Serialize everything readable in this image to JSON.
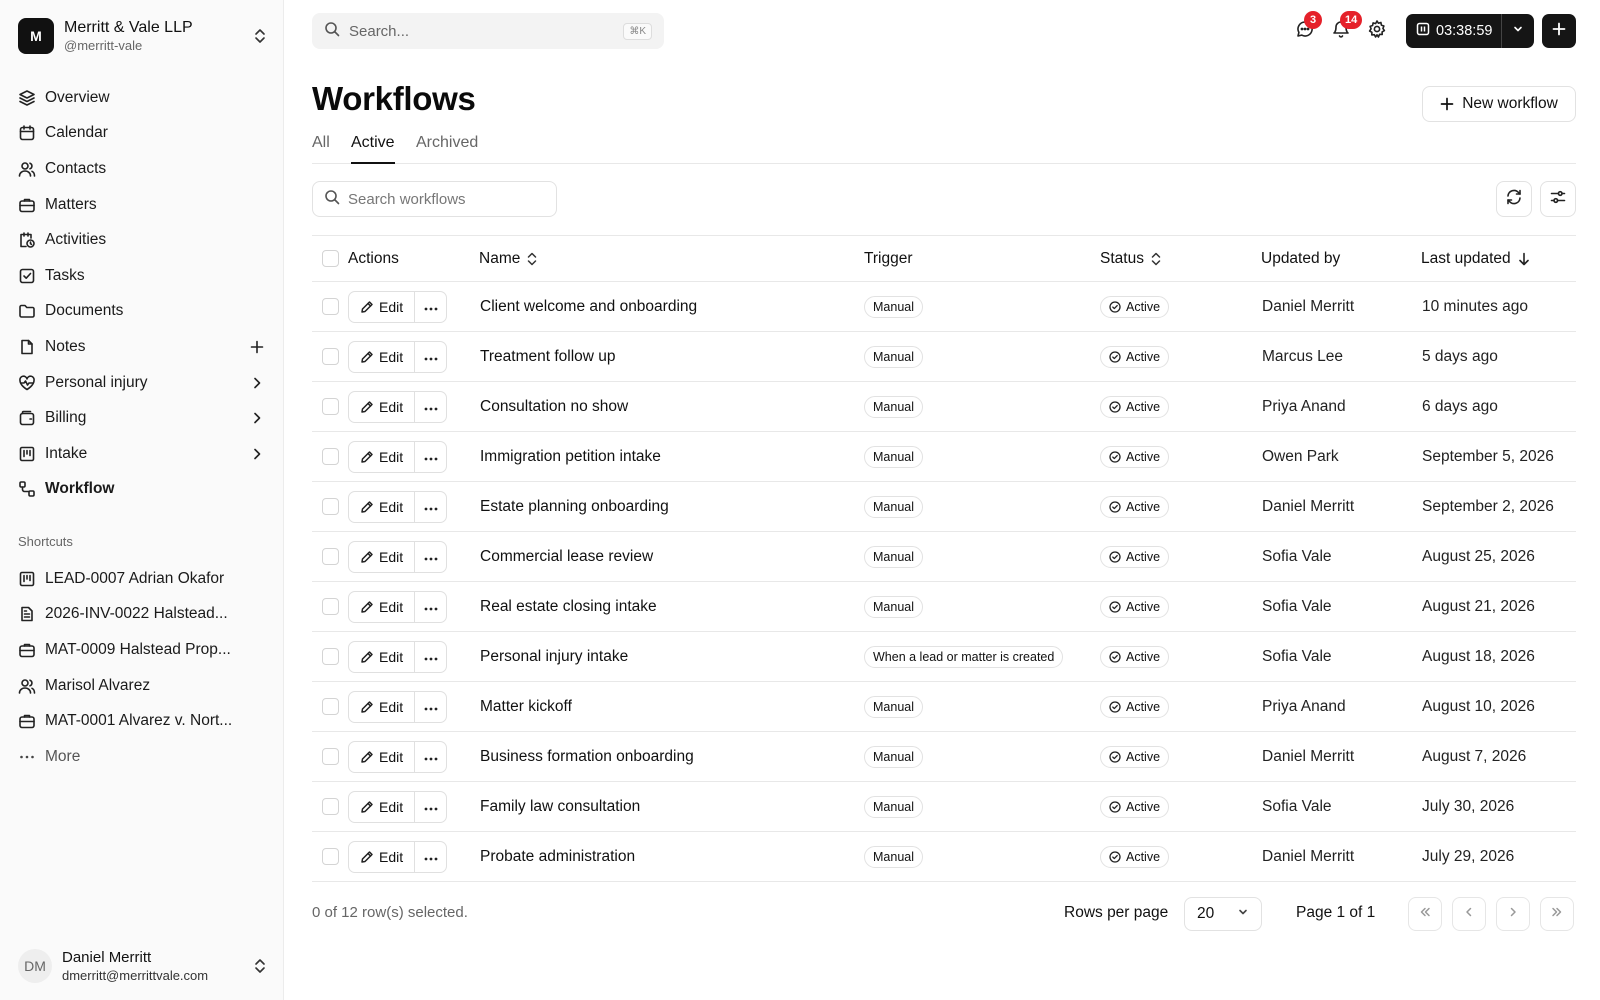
{
  "team": {
    "initial": "M",
    "name": "Merritt & Vale LLP",
    "handle": "@merritt-vale"
  },
  "nav": [
    {
      "label": "Overview",
      "icon": "layers-icon"
    },
    {
      "label": "Calendar",
      "icon": "calendar-icon"
    },
    {
      "label": "Contacts",
      "icon": "contacts-icon"
    },
    {
      "label": "Matters",
      "icon": "briefcase-icon"
    },
    {
      "label": "Activities",
      "icon": "activities-icon"
    },
    {
      "label": "Tasks",
      "icon": "task-check-icon"
    },
    {
      "label": "Documents",
      "icon": "folder-icon"
    },
    {
      "label": "Notes",
      "icon": "note-icon",
      "trail": "plus-icon"
    },
    {
      "label": "Personal injury",
      "icon": "heart-pulse-icon",
      "trail": "chevron-right-icon"
    },
    {
      "label": "Billing",
      "icon": "wallet-icon",
      "trail": "chevron-right-icon"
    },
    {
      "label": "Intake",
      "icon": "kanban-icon",
      "trail": "chevron-right-icon"
    },
    {
      "label": "Workflow",
      "icon": "workflow-icon",
      "active": true
    }
  ],
  "shortcuts": {
    "label": "Shortcuts",
    "items": [
      {
        "label": "LEAD-0007 Adrian Okafor",
        "icon": "kanban-icon"
      },
      {
        "label": "2026-INV-0022 Halstead...",
        "icon": "invoice-icon"
      },
      {
        "label": "MAT-0009 Halstead Prop...",
        "icon": "briefcase-icon"
      },
      {
        "label": "Marisol Alvarez",
        "icon": "contacts-icon"
      },
      {
        "label": "MAT-0001 Alvarez v. Nort...",
        "icon": "briefcase-icon"
      },
      {
        "label": "More",
        "icon": "ellipsis-icon"
      }
    ]
  },
  "user": {
    "initials": "DM",
    "name": "Daniel Merritt",
    "email": "dmerritt@merrittvale.com"
  },
  "topbar": {
    "search_label": "Search...",
    "search_shortcut": "⌘K",
    "messages_badge": "3",
    "notifications_badge": "14",
    "timer": "03:38:59"
  },
  "page": {
    "title": "Workflows",
    "new_button": "New workflow",
    "tabs": [
      {
        "label": "All"
      },
      {
        "label": "Active",
        "active": true
      },
      {
        "label": "Archived"
      }
    ],
    "search_placeholder": "Search workflows"
  },
  "table": {
    "headers": {
      "actions": "Actions",
      "name": "Name",
      "trigger": "Trigger",
      "status": "Status",
      "updated_by": "Updated by",
      "last_updated": "Last updated"
    },
    "edit_label": "Edit",
    "rows": [
      {
        "name": "Client welcome and onboarding",
        "trigger": "Manual",
        "status": "Active",
        "updated_by": "Daniel Merritt",
        "last_updated": "10 minutes ago"
      },
      {
        "name": "Treatment follow up",
        "trigger": "Manual",
        "status": "Active",
        "updated_by": "Marcus Lee",
        "last_updated": "5 days ago"
      },
      {
        "name": "Consultation no show",
        "trigger": "Manual",
        "status": "Active",
        "updated_by": "Priya Anand",
        "last_updated": "6 days ago"
      },
      {
        "name": "Immigration petition intake",
        "trigger": "Manual",
        "status": "Active",
        "updated_by": "Owen Park",
        "last_updated": "September 5, 2026"
      },
      {
        "name": "Estate planning onboarding",
        "trigger": "Manual",
        "status": "Active",
        "updated_by": "Daniel Merritt",
        "last_updated": "September 2, 2026"
      },
      {
        "name": "Commercial lease review",
        "trigger": "Manual",
        "status": "Active",
        "updated_by": "Sofia Vale",
        "last_updated": "August 25, 2026"
      },
      {
        "name": "Real estate closing intake",
        "trigger": "Manual",
        "status": "Active",
        "updated_by": "Sofia Vale",
        "last_updated": "August 21, 2026"
      },
      {
        "name": "Personal injury intake",
        "trigger": "When a lead or matter is created",
        "status": "Active",
        "updated_by": "Sofia Vale",
        "last_updated": "August 18, 2026"
      },
      {
        "name": "Matter kickoff",
        "trigger": "Manual",
        "status": "Active",
        "updated_by": "Priya Anand",
        "last_updated": "August 10, 2026"
      },
      {
        "name": "Business formation onboarding",
        "trigger": "Manual",
        "status": "Active",
        "updated_by": "Daniel Merritt",
        "last_updated": "August 7, 2026"
      },
      {
        "name": "Family law consultation",
        "trigger": "Manual",
        "status": "Active",
        "updated_by": "Sofia Vale",
        "last_updated": "July 30, 2026"
      },
      {
        "name": "Probate administration",
        "trigger": "Manual",
        "status": "Active",
        "updated_by": "Daniel Merritt",
        "last_updated": "July 29, 2026"
      }
    ]
  },
  "footer": {
    "selection": "0 of 12 row(s) selected.",
    "rows_per_page_label": "Rows per page",
    "rows_per_page": "20",
    "page_info": "Page 1 of 1"
  },
  "colors": {
    "accent": "#111111",
    "badge": "#e5212a",
    "border": "#e8e8e8",
    "muted": "#666666"
  }
}
